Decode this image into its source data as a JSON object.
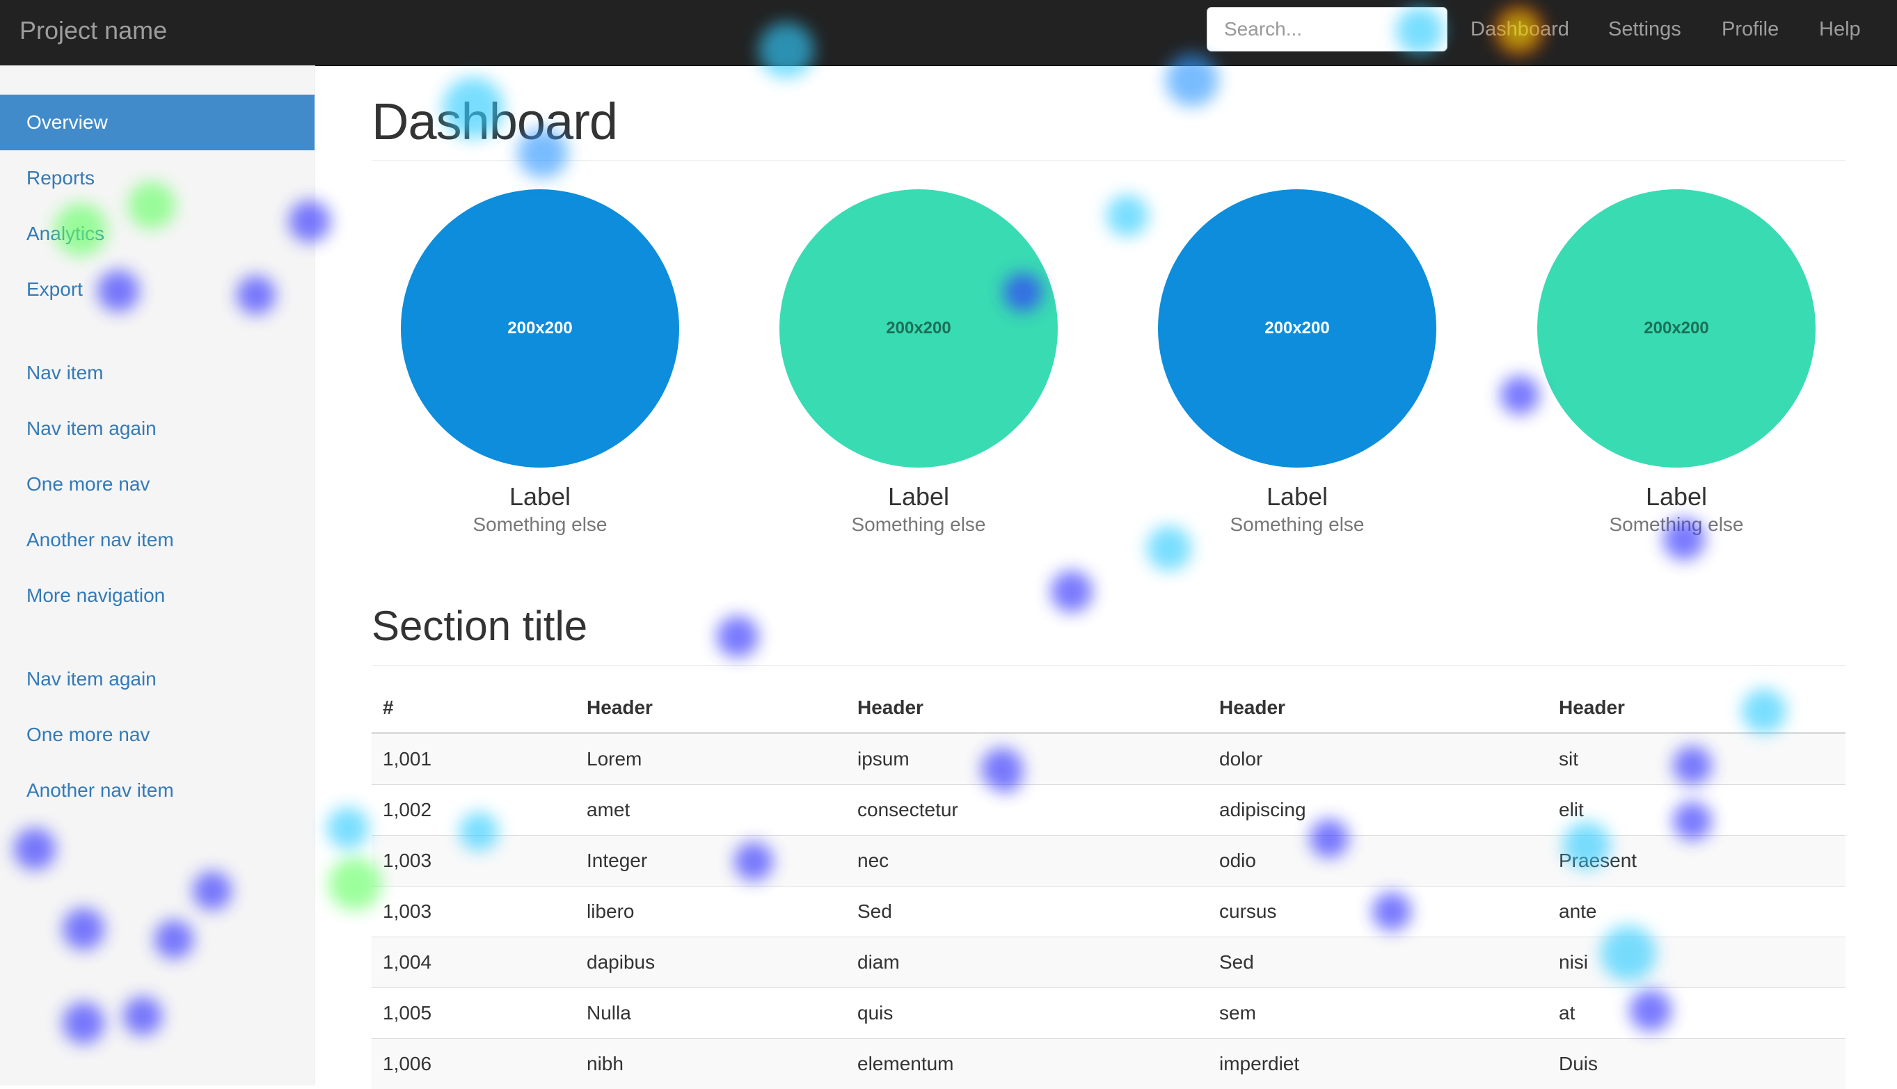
{
  "navbar": {
    "brand": "Project name",
    "search_placeholder": "Search...",
    "links": [
      "Dashboard",
      "Settings",
      "Profile",
      "Help"
    ]
  },
  "sidebar": {
    "groups": [
      [
        "Overview",
        "Reports",
        "Analytics",
        "Export"
      ],
      [
        "Nav item",
        "Nav item again",
        "One more nav",
        "Another nav item",
        "More navigation"
      ],
      [
        "Nav item again",
        "One more nav",
        "Another nav item"
      ]
    ],
    "active": "Overview"
  },
  "main": {
    "title": "Dashboard",
    "placeholders": [
      {
        "image_text": "200x200",
        "label": "Label",
        "caption": "Something else",
        "color": "#0d8ddb"
      },
      {
        "image_text": "200x200",
        "label": "Label",
        "caption": "Something else",
        "color": "#39dbb2"
      },
      {
        "image_text": "200x200",
        "label": "Label",
        "caption": "Something else",
        "color": "#0d8ddb"
      },
      {
        "image_text": "200x200",
        "label": "Label",
        "caption": "Something else",
        "color": "#39dbb2"
      }
    ],
    "section_title": "Section title",
    "table": {
      "headers": [
        "#",
        "Header",
        "Header",
        "Header",
        "Header"
      ],
      "rows": [
        [
          "1,001",
          "Lorem",
          "ipsum",
          "dolor",
          "sit"
        ],
        [
          "1,002",
          "amet",
          "consectetur",
          "adipiscing",
          "elit"
        ],
        [
          "1,003",
          "Integer",
          "nec",
          "odio",
          "Praesent"
        ],
        [
          "1,003",
          "libero",
          "Sed",
          "cursus",
          "ante"
        ],
        [
          "1,004",
          "dapibus",
          "diam",
          "Sed",
          "nisi"
        ],
        [
          "1,005",
          "Nulla",
          "quis",
          "sem",
          "at"
        ],
        [
          "1,006",
          "nibh",
          "elementum",
          "imperdiet",
          "Duis"
        ]
      ]
    }
  },
  "colors": {
    "navbar_bg": "#222222",
    "accent": "#428bca",
    "link": "#337ab7",
    "placeholder_dark": "#0d8ddb",
    "placeholder_light": "#39dbb2"
  }
}
